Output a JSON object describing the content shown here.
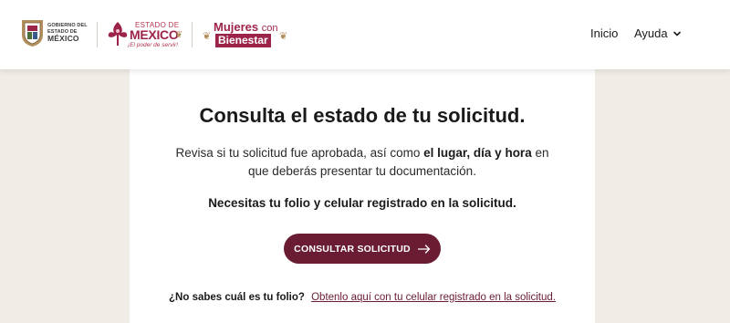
{
  "header": {
    "gobierno_logo": {
      "line1": "GOBIERNO DEL",
      "line2": "ESTADO DE",
      "line3": "MÉXICO"
    },
    "edomex_logo": {
      "estado": "ESTADO DE",
      "mexico": "MEXICO",
      "tagline": "¡El poder de servir!"
    },
    "mujeres_logo": {
      "mujeres": "Mujeres",
      "con": "con",
      "bienestar": "Bienestar"
    },
    "nav": {
      "inicio": "Inicio",
      "ayuda": "Ayuda"
    }
  },
  "main": {
    "title": "Consulta el estado de tu solicitud.",
    "description": {
      "part1": "Revisa si tu solicitud fue aprobada, así como ",
      "bold": "el lugar, día y hora",
      "part2": " en que deberás presentar tu documentación."
    },
    "requirement": "Necesitas tu folio y celular registrado en la solicitud.",
    "button_label": "CONSULTAR SOLICITUD",
    "folio_question": "¿No sabes cuál es tu folio?",
    "folio_link": "Obtenlo aquí con tu celular registrado en la solicitud."
  },
  "colors": {
    "primary": "#691c32",
    "brand_red": "#9d2449",
    "gold": "#b38e5d",
    "background": "#f0ede6"
  },
  "icons": {
    "arrow": "arrow-right-icon",
    "chevron": "chevron-down-icon"
  }
}
